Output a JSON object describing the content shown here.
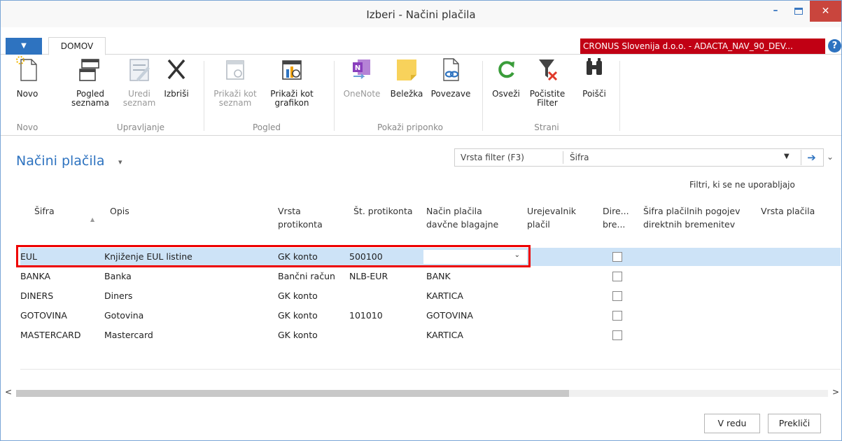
{
  "window": {
    "title": "Izberi - Načini plačila",
    "min": "–",
    "close": "✕"
  },
  "tabs": {
    "menu": "▼",
    "domov": "DOMOV",
    "company": "CRONUS Slovenija d.o.o. - ADACTA_NAV_90_DEV...",
    "help": "?"
  },
  "ribbon": {
    "novo": [
      "Novo"
    ],
    "pogled_seznama": [
      "Pogled",
      "seznama"
    ],
    "uredi_seznam": [
      "Uredi",
      "seznam"
    ],
    "izbrisi": [
      "Izbriši"
    ],
    "prikazi_seznam": [
      "Prikaži kot",
      "seznam"
    ],
    "prikazi_grafikon": [
      "Prikaži kot",
      "grafikon"
    ],
    "onenote": [
      "OneNote"
    ],
    "belezka": [
      "Beležka"
    ],
    "povezave": [
      "Povezave"
    ],
    "osvezi": [
      "Osveži"
    ],
    "pocistite": [
      "Počistite",
      "Filter"
    ],
    "poisci": [
      "Poišči"
    ],
    "groups": [
      "Novo",
      "Upravljanje",
      "Pogled",
      "Pokaži priponko",
      "Strani"
    ]
  },
  "page": {
    "title": "Načini plačila",
    "title_caret": "▾",
    "filter_label": "Vrsta filter (F3)",
    "filter_field": "Šifra",
    "filter_dd": "▼",
    "filter_go": "➔",
    "collapse": "⌄",
    "filters_note": "Filtri, ki se ne uporabljajo"
  },
  "columns": {
    "sifra": [
      "Šifra"
    ],
    "opis": [
      "Opis"
    ],
    "vrsta": [
      "Vrsta",
      "protikonta"
    ],
    "st": [
      "Št. protikonta"
    ],
    "nacin": [
      "Način plačila",
      "davčne blagajne"
    ],
    "urej": [
      "Urejevalnik",
      "plačil"
    ],
    "dire": [
      "Dire...",
      "bre..."
    ],
    "sifra_pog": [
      "Šifra plačilnih pogojev",
      "direktnih bremenitev"
    ],
    "vrsta_pl": [
      "Vrsta plačila"
    ],
    "sort": "▲"
  },
  "rows": [
    {
      "sifra": "EUL",
      "opis": "Knjiženje EUL listine",
      "vrsta": "GK konto",
      "st": "500100",
      "nacin": ""
    },
    {
      "sifra": "BANKA",
      "opis": "Banka",
      "vrsta": "Bančni račun",
      "st": "NLB-EUR",
      "nacin": "BANK"
    },
    {
      "sifra": "DINERS",
      "opis": "Diners",
      "vrsta": "GK konto",
      "st": "",
      "nacin": "KARTICA"
    },
    {
      "sifra": "GOTOVINA",
      "opis": "Gotovina",
      "vrsta": "GK konto",
      "st": "101010",
      "nacin": "GOTOVINA"
    },
    {
      "sifra": "MASTERCARD",
      "opis": "Mastercard",
      "vrsta": "GK konto",
      "st": "",
      "nacin": "KARTICA"
    }
  ],
  "edit_dd": "⌄",
  "scroll": {
    "left": "<",
    "right": ">"
  },
  "footer": {
    "ok": "V redu",
    "cancel": "Prekliči"
  }
}
